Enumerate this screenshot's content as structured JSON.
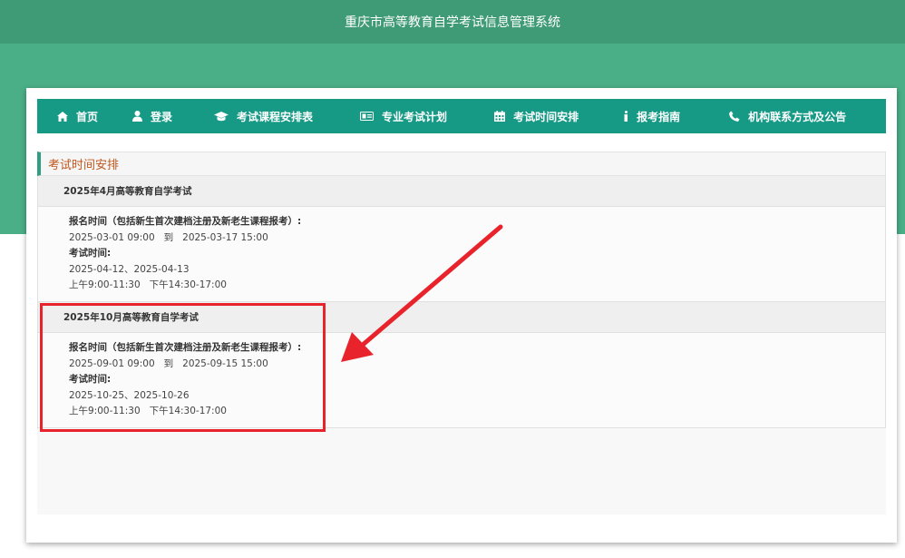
{
  "site": {
    "title": "重庆市高等教育自学考试信息管理系统"
  },
  "nav": {
    "items": [
      {
        "label": "首页",
        "icon": "home-icon"
      },
      {
        "label": "登录",
        "icon": "user-icon"
      },
      {
        "label": "考试课程安排表",
        "icon": "graduation-cap-icon"
      },
      {
        "label": "专业考试计划",
        "icon": "id-card-icon"
      },
      {
        "label": "考试时间安排",
        "icon": "calendar-icon"
      },
      {
        "label": "报考指南",
        "icon": "info-icon"
      },
      {
        "label": "机构联系方式及公告",
        "icon": "phone-icon"
      }
    ]
  },
  "panel": {
    "heading": "考试时间安排",
    "exams": [
      {
        "title": "2025年4月高等教育自学考试",
        "reg_label": "报名时间（包括新生首次建档注册及新老生课程报考）:",
        "reg_range": "2025-03-01 09:00   到   2025-03-17 15:00",
        "exam_label": "考试时间:",
        "exam_dates": "2025-04-12、2025-04-13",
        "exam_sessions": "上午9:00-11:30   下午14:30-17:00"
      },
      {
        "title": "2025年10月高等教育自学考试",
        "reg_label": "报名时间（包括新生首次建档注册及新老生课程报考）:",
        "reg_range": "2025-09-01 09:00   到   2025-09-15 15:00",
        "exam_label": "考试时间:",
        "exam_dates": "2025-10-25、2025-10-26",
        "exam_sessions": "上午9:00-11:30   下午14:30-17:00"
      }
    ]
  },
  "colors": {
    "header": "#3f9a76",
    "band": "#4aaf87",
    "nav": "#169a86",
    "accent": "#c0571d",
    "annotation": "#e8232b"
  }
}
